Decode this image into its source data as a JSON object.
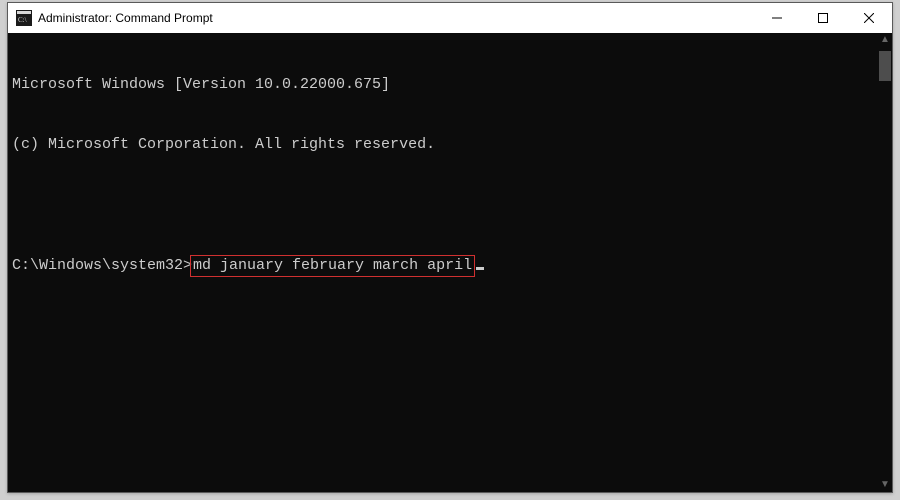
{
  "window": {
    "title": "Administrator: Command Prompt"
  },
  "terminal": {
    "header_line1": "Microsoft Windows [Version 10.0.22000.675]",
    "header_line2": "(c) Microsoft Corporation. All rights reserved.",
    "prompt": "C:\\Windows\\system32>",
    "command": "md january february march april"
  }
}
